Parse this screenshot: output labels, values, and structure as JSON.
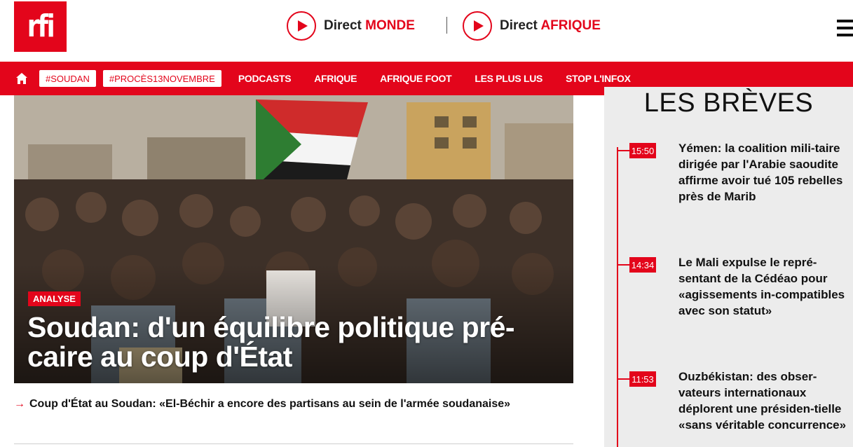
{
  "header": {
    "logo_text": "rfi",
    "live": [
      {
        "prefix": "Direct",
        "name": "MONDE"
      },
      {
        "prefix": "Direct",
        "name": "AFRIQUE"
      }
    ],
    "menu_icon": "hamburger-menu-icon"
  },
  "nav": {
    "home_icon": "home-icon",
    "tags": [
      "#SOUDAN",
      "#PROCÈS13NOVEMBRE"
    ],
    "links": [
      "PODCASTS",
      "AFRIQUE",
      "AFRIQUE FOOT",
      "LES PLUS LUS",
      "STOP L'INFOX"
    ]
  },
  "hero": {
    "badge": "ANALYSE",
    "title": "Soudan: d'un équilibre politique pré-caire au coup d'État",
    "related": "Coup d'État au Soudan: «El-Béchir a encore des partisans au sein de l'armée soudanaise»"
  },
  "breves": {
    "title": "LES BRÈVES",
    "items": [
      {
        "time": "15:50",
        "text": "Yémen: la coalition mili-taire dirigée par l'Arabie saoudite affirme avoir tué 105 rebelles près de Marib"
      },
      {
        "time": "14:34",
        "text": "Le Mali expulse le repré-sentant de la Cédéao pour «agissements in-compatibles avec son statut»"
      },
      {
        "time": "11:53",
        "text": "Ouzbékistan: des obser-vateurs internationaux déplorent une présiden-tielle «sans véritable concurrence»"
      }
    ]
  },
  "colors": {
    "brand": "#e3051b",
    "sidebar_bg": "#ececec"
  }
}
